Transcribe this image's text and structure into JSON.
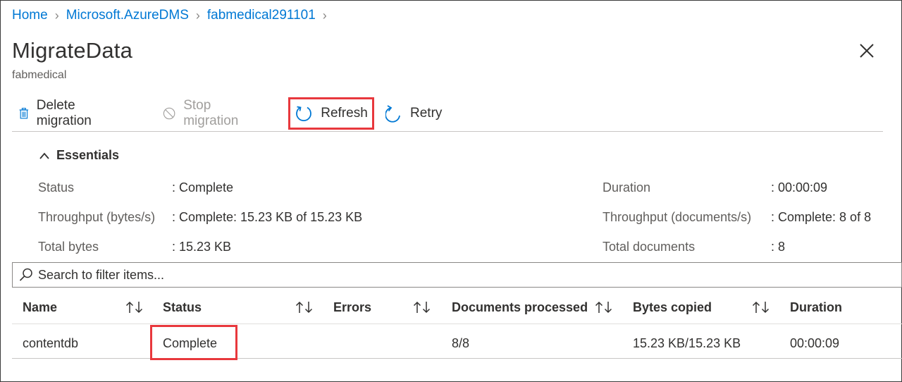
{
  "breadcrumb": {
    "items": [
      "Home",
      "Microsoft.AzureDMS",
      "fabmedical291101"
    ]
  },
  "header": {
    "title": "MigrateData",
    "subtitle": "fabmedical"
  },
  "toolbar": {
    "delete_label": "Delete migration",
    "stop_label": "Stop migration",
    "refresh_label": "Refresh",
    "retry_label": "Retry"
  },
  "essentials": {
    "toggle_label": "Essentials",
    "left": [
      {
        "label": "Status",
        "value": ": Complete"
      },
      {
        "label": "Throughput (bytes/s)",
        "value": ": Complete: 15.23 KB of 15.23 KB"
      },
      {
        "label": "Total bytes",
        "value": ": 15.23 KB"
      }
    ],
    "right": [
      {
        "label": "Duration",
        "value": ": 00:00:09"
      },
      {
        "label": "Throughput (documents/s)",
        "value": ": Complete: 8 of 8"
      },
      {
        "label": "Total documents",
        "value": ": 8"
      }
    ]
  },
  "search": {
    "placeholder": "Search to filter items..."
  },
  "table": {
    "columns": [
      "Name",
      "Status",
      "Errors",
      "Documents processed",
      "Bytes copied",
      "Duration"
    ],
    "rows": [
      {
        "name": "contentdb",
        "status": "Complete",
        "errors": "",
        "documents": "8/8",
        "bytes": "15.23 KB/15.23 KB",
        "duration": "00:00:09"
      }
    ]
  },
  "colors": {
    "link": "#0078d4",
    "highlight": "#e8383d",
    "disabled": "#a19f9d"
  }
}
